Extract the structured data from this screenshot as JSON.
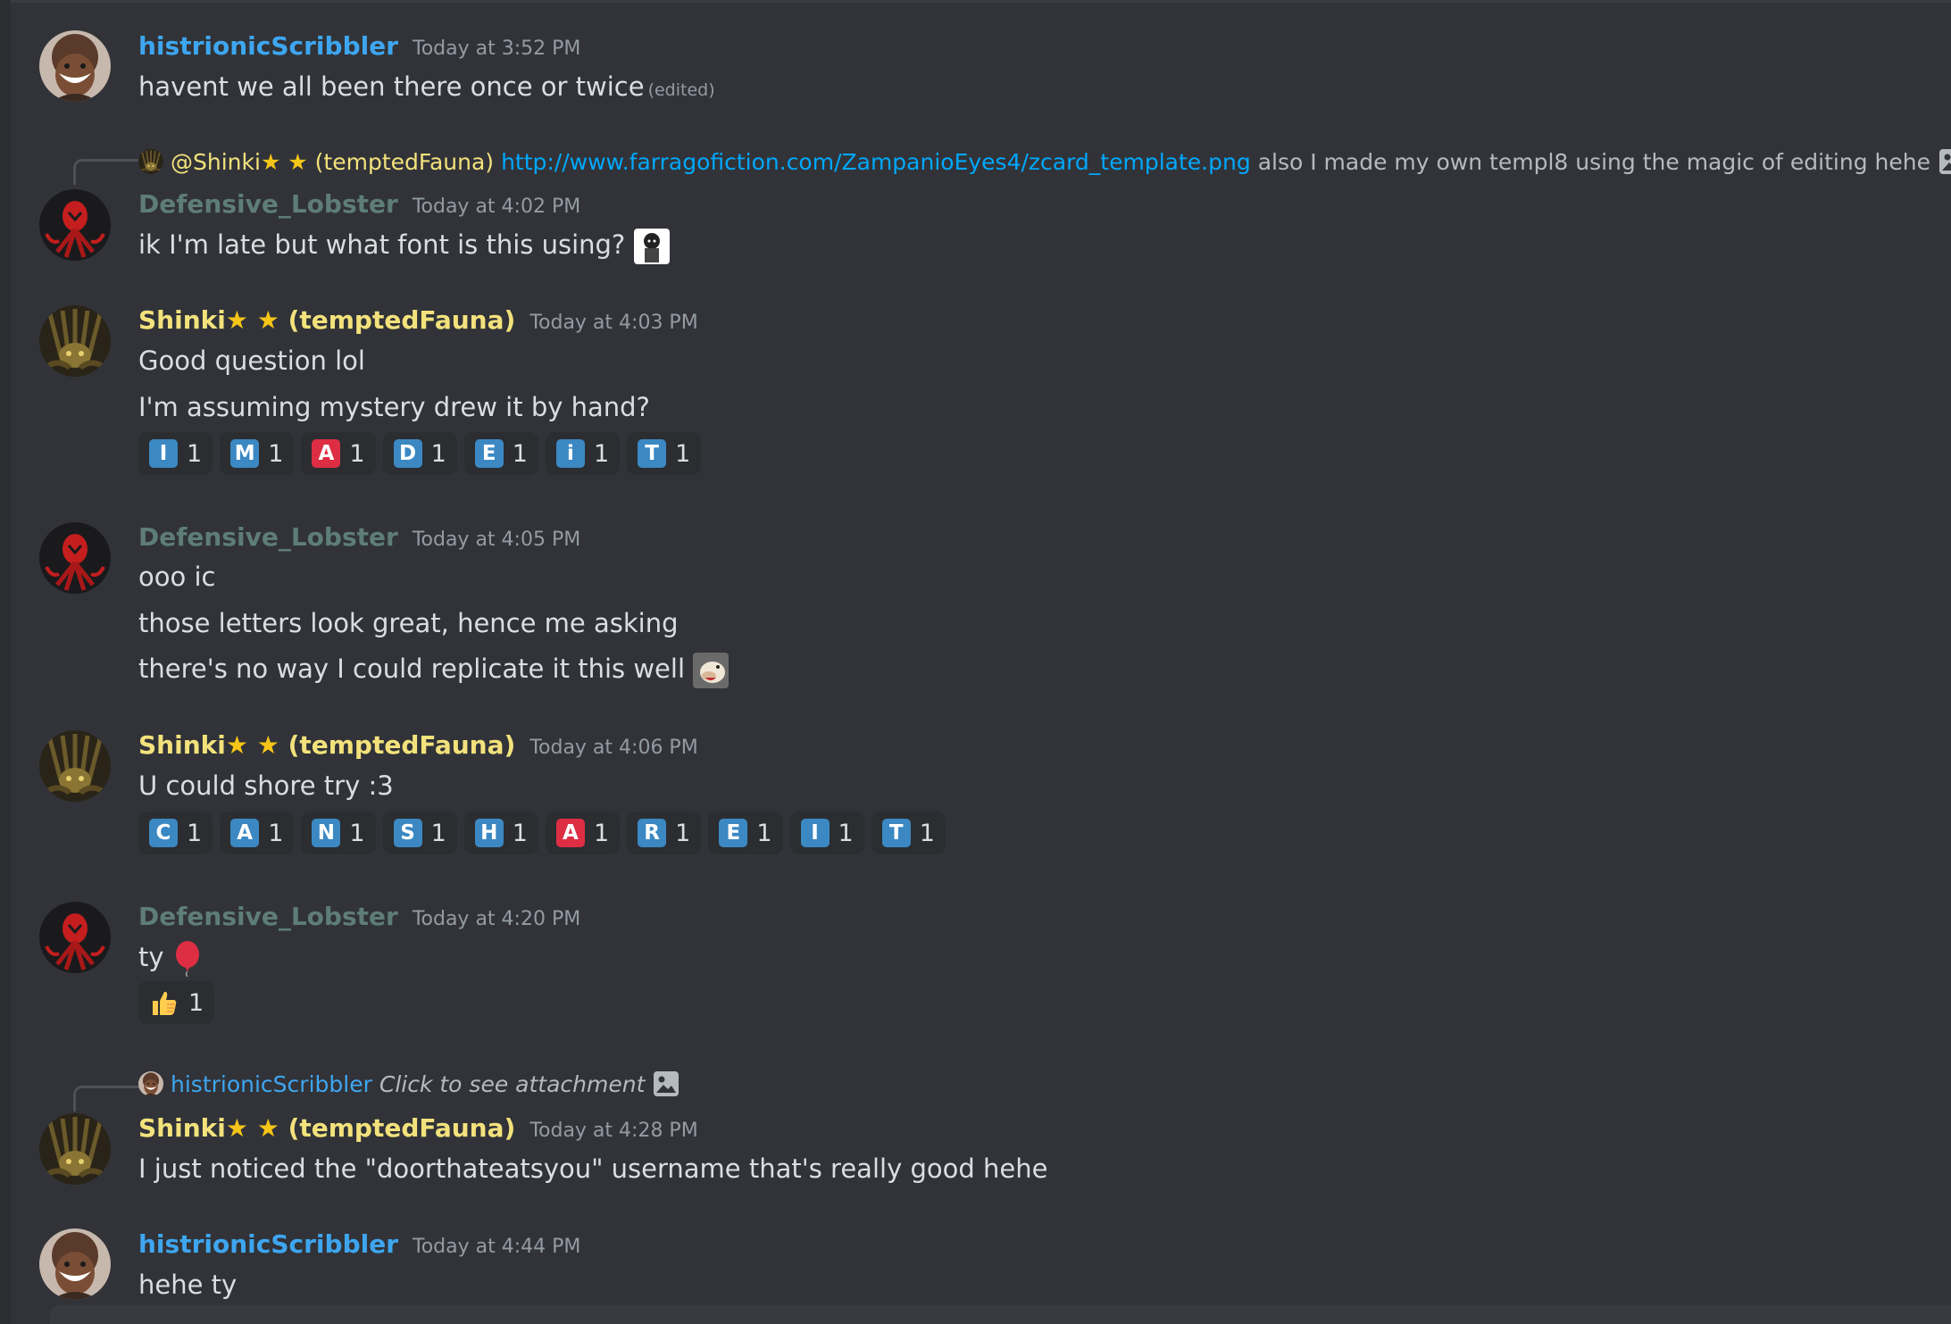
{
  "messages": [
    {
      "author": "histrionicScribbler",
      "timestamp": "Today at 3:52 PM",
      "lines": [
        "havent we all been there once or twice"
      ],
      "edited": "(edited)"
    },
    {
      "reply": {
        "author": "@Shinki",
        "author_suffix": "(temptedFauna)",
        "link": "http://www.farragofiction.com/ZampanioEyes4/zcard_template.png",
        "text": "also I made my own templ8 using the magic of editing hehe"
      },
      "author": "Defensive_Lobster",
      "timestamp": "Today at 4:02 PM",
      "lines": [
        "ik I'm late but what font is this using?"
      ]
    },
    {
      "author": "Shinki",
      "author_suffix": "(temptedFauna)",
      "timestamp": "Today at 4:03 PM",
      "lines": [
        "Good question lol",
        "I'm assuming mystery drew it by hand?"
      ],
      "reactions": [
        {
          "letter": "I",
          "color": "#3b88c3",
          "count": "1"
        },
        {
          "letter": "M",
          "color": "#3b88c3",
          "count": "1"
        },
        {
          "letter": "A",
          "color": "#dd2e44",
          "count": "1"
        },
        {
          "letter": "D",
          "color": "#3b88c3",
          "count": "1"
        },
        {
          "letter": "E",
          "color": "#3b88c3",
          "count": "1"
        },
        {
          "letter": "i",
          "color": "#3b88c3",
          "count": "1"
        },
        {
          "letter": "T",
          "color": "#3b88c3",
          "count": "1"
        }
      ]
    },
    {
      "author": "Defensive_Lobster",
      "timestamp": "Today at 4:05 PM",
      "lines": [
        "ooo ic",
        "those letters look great, hence me asking",
        "there's no way I could replicate it this well"
      ]
    },
    {
      "author": "Shinki",
      "author_suffix": "(temptedFauna)",
      "timestamp": "Today at 4:06 PM",
      "lines": [
        "U could shore try :3"
      ],
      "reactions": [
        {
          "letter": "C",
          "color": "#3b88c3",
          "count": "1"
        },
        {
          "letter": "A",
          "color": "#3b88c3",
          "count": "1"
        },
        {
          "letter": "N",
          "color": "#3b88c3",
          "count": "1"
        },
        {
          "letter": "S",
          "color": "#3b88c3",
          "count": "1"
        },
        {
          "letter": "H",
          "color": "#3b88c3",
          "count": "1"
        },
        {
          "letter": "A",
          "color": "#dd2e44",
          "count": "1"
        },
        {
          "letter": "R",
          "color": "#3b88c3",
          "count": "1"
        },
        {
          "letter": "E",
          "color": "#3b88c3",
          "count": "1"
        },
        {
          "letter": "I",
          "color": "#3b88c3",
          "count": "1"
        },
        {
          "letter": "T",
          "color": "#3b88c3",
          "count": "1"
        }
      ]
    },
    {
      "author": "Defensive_Lobster",
      "timestamp": "Today at 4:20 PM",
      "lines": [
        "ty"
      ],
      "reactions": [
        {
          "emoji": "thumbs-up-icon",
          "count": "1"
        }
      ]
    },
    {
      "reply": {
        "author": "histrionicScribbler",
        "text": "Click to see attachment"
      },
      "author": "Shinki",
      "author_suffix": "(temptedFauna)",
      "timestamp": "Today at 4:28 PM",
      "lines": [
        "I just noticed the \"doorthateatsyou\" username that's really good hehe"
      ]
    },
    {
      "author": "histrionicScribbler",
      "timestamp": "Today at 4:44 PM",
      "lines": [
        "hehe ty"
      ]
    }
  ],
  "stars": "★ ★",
  "colors": {
    "background": "#313338",
    "histrionic": "#3ea6f0",
    "lobster": "#5e7d77",
    "shinki": "#f3e27c",
    "link": "#00a8fc"
  }
}
